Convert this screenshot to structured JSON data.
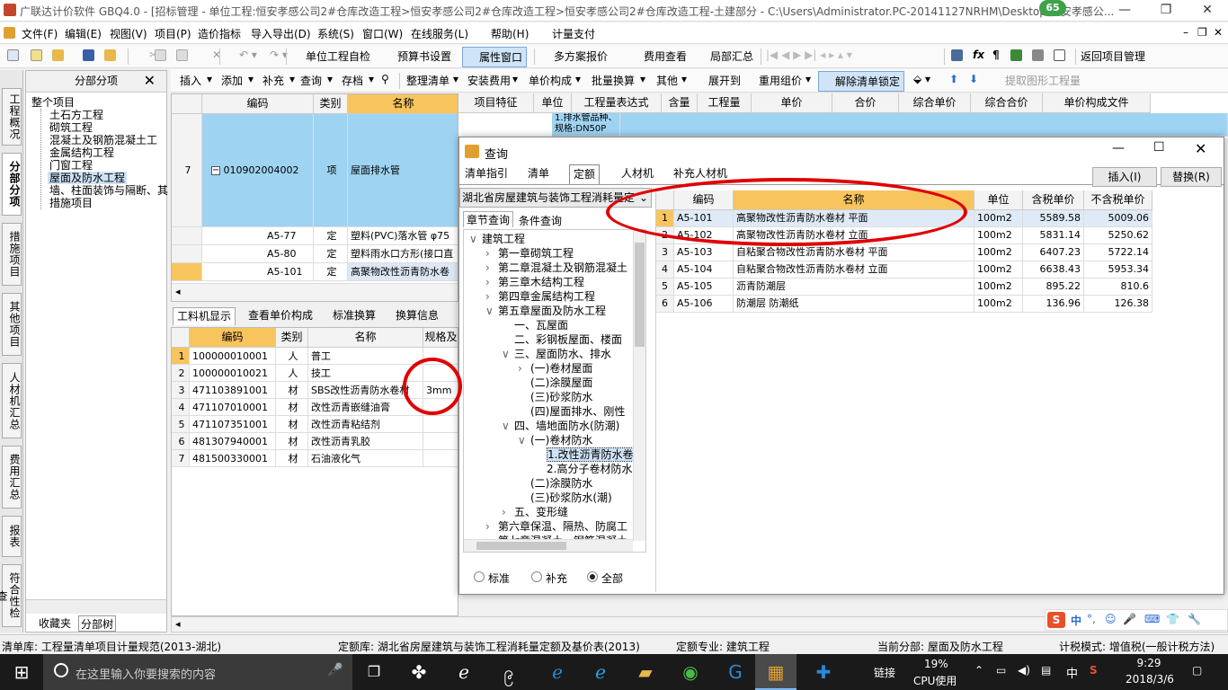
{
  "window": {
    "title": "广联达计价软件 GBQ4.0 - [招标管理 - 单位工程:恒安孝感公司2#仓库改造工程>恒安孝感公司2#仓库改造工程>恒安孝感公司2#仓库改造工程-土建部分 - C:\\Users\\Administrator.PC-20141127NRHM\\Desktop\\恒安孝感公...",
    "badge": "65"
  },
  "menu": [
    "文件(F)",
    "编辑(E)",
    "视图(V)",
    "项目(P)",
    "造价指标",
    "导入导出(D)",
    "系统(S)",
    "窗口(W)",
    "在线服务(L)",
    "帮助(H)",
    "计量支付"
  ],
  "toolbar1": [
    "单位工程自检",
    "预算书设置",
    "属性窗口",
    "多方案报价",
    "费用查看",
    "局部汇总",
    "返回项目管理"
  ],
  "toolbar2": [
    "插入",
    "添加",
    "补充",
    "查询",
    "存档",
    "整理清单",
    "安装费用",
    "单价构成",
    "批量换算",
    "其他",
    "展开到",
    "重用组价",
    "解除清单锁定",
    "提取图形工程量"
  ],
  "vtabs": [
    "工程概况",
    "分部分项",
    "措施项目",
    "其他项目",
    "人材机汇总",
    "费用汇总",
    "报表",
    "符合性检查"
  ],
  "leftpanel": {
    "title": "分部分项",
    "items": [
      "整个项目",
      "土石方工程",
      "砌筑工程",
      "混凝土及钢筋混凝土工",
      "金属结构工程",
      "门窗工程",
      "屋面及防水工程",
      "墙、柱面装饰与隔断、其",
      "措施项目"
    ],
    "bottom_tabs": [
      "收藏夹",
      "分部树"
    ]
  },
  "maingrid": {
    "headers": [
      "编码",
      "类别",
      "名称",
      "项目特征",
      "单位",
      "工程量表达式",
      "含量",
      "工程量",
      "单价",
      "合价",
      "综合单价",
      "综合合价",
      "单价构成文件"
    ],
    "rows": [
      {
        "no": "7",
        "code": "010902004002",
        "type": "项",
        "name": "屋面排水管",
        "feature": "1.排水管品种、规格:DN50P"
      },
      {
        "no": "",
        "code": "A5-77",
        "type": "定",
        "name": "塑料(PVC)落水管 φ75"
      },
      {
        "no": "",
        "code": "A5-80",
        "type": "定",
        "name": "塑料雨水口方形(接口直"
      },
      {
        "no": "",
        "code": "A5-101",
        "type": "定",
        "name": "高聚物改性沥青防水卷"
      }
    ]
  },
  "bottomtabs": [
    "工料机显示",
    "查看单价构成",
    "标准换算",
    "换算信息"
  ],
  "bottomgrid": {
    "headers": [
      "编码",
      "类别",
      "名称",
      "规格及"
    ],
    "rows": [
      {
        "no": "1",
        "code": "100000010001",
        "type": "人",
        "name": "普工",
        "spec": ""
      },
      {
        "no": "2",
        "code": "100000010021",
        "type": "人",
        "name": "技工",
        "spec": ""
      },
      {
        "no": "3",
        "code": "471103891001",
        "type": "材",
        "name": "SBS改性沥青防水卷材",
        "spec": "3mm"
      },
      {
        "no": "4",
        "code": "471107010001",
        "type": "材",
        "name": "改性沥青嵌缝油膏",
        "spec": ""
      },
      {
        "no": "5",
        "code": "471107351001",
        "type": "材",
        "name": "改性沥青粘结剂",
        "spec": ""
      },
      {
        "no": "6",
        "code": "481307940001",
        "type": "材",
        "name": "改性沥青乳胶",
        "spec": ""
      },
      {
        "no": "7",
        "code": "481500330001",
        "type": "材",
        "name": "石油液化气",
        "spec": ""
      }
    ]
  },
  "dialog": {
    "title": "查询",
    "tabs": [
      "清单指引",
      "清单",
      "定额",
      "人材机",
      "补充人材机"
    ],
    "insert": "插入(I)",
    "replace": "替换(R)",
    "library": "湖北省房屋建筑与装饰工程消耗量定",
    "subtabs": [
      "章节查询",
      "条件查询"
    ],
    "tree": [
      {
        "label": "建筑工程",
        "lv": 0,
        "exp": "v"
      },
      {
        "label": "第一章砌筑工程",
        "lv": 1,
        "exp": ">"
      },
      {
        "label": "第二章混凝土及钢筋混凝土",
        "lv": 1,
        "exp": ">"
      },
      {
        "label": "第三章木结构工程",
        "lv": 1,
        "exp": ">"
      },
      {
        "label": "第四章金属结构工程",
        "lv": 1,
        "exp": ">"
      },
      {
        "label": "第五章屋面及防水工程",
        "lv": 1,
        "exp": "v"
      },
      {
        "label": "一、瓦屋面",
        "lv": 2,
        "exp": ""
      },
      {
        "label": "二、彩钢板屋面、楼面",
        "lv": 2,
        "exp": ""
      },
      {
        "label": "三、屋面防水、排水",
        "lv": 2,
        "exp": "v"
      },
      {
        "label": "(一)卷材屋面",
        "lv": 3,
        "exp": ">"
      },
      {
        "label": "(二)涂膜屋面",
        "lv": 3,
        "exp": ""
      },
      {
        "label": "(三)砂浆防水",
        "lv": 3,
        "exp": ""
      },
      {
        "label": "(四)屋面排水、刚性",
        "lv": 3,
        "exp": ""
      },
      {
        "label": "四、墙地面防水(防潮)",
        "lv": 2,
        "exp": "v"
      },
      {
        "label": "(一)卷材防水",
        "lv": 3,
        "exp": "v"
      },
      {
        "label": "1.改性沥青防水卷",
        "lv": 4,
        "exp": ""
      },
      {
        "label": "2.高分子卷材防水",
        "lv": 4,
        "exp": ""
      },
      {
        "label": "(二)涂膜防水",
        "lv": 3,
        "exp": ""
      },
      {
        "label": "(三)砂浆防水(潮)",
        "lv": 3,
        "exp": ""
      },
      {
        "label": "五、变形缝",
        "lv": 2,
        "exp": ">"
      },
      {
        "label": "第六章保温、隔热、防腐工",
        "lv": 1,
        "exp": ">"
      },
      {
        "label": "第七章混凝土、钢筋混凝土",
        "lv": 1,
        "exp": ">"
      }
    ],
    "radios": [
      "标准",
      "补充",
      "全部"
    ],
    "grid_headers": [
      "编码",
      "名称",
      "单位",
      "含税单价",
      "不含税单价"
    ],
    "rows": [
      {
        "no": "1",
        "code": "A5-101",
        "name": "高聚物改性沥青防水卷材 平面",
        "unit": "100m2",
        "tax": "5589.58",
        "notax": "5009.06"
      },
      {
        "no": "2",
        "code": "A5-102",
        "name": "高聚物改性沥青防水卷材 立面",
        "unit": "100m2",
        "tax": "5831.14",
        "notax": "5250.62"
      },
      {
        "no": "3",
        "code": "A5-103",
        "name": "自粘聚合物改性沥青防水卷材 平面",
        "unit": "100m2",
        "tax": "6407.23",
        "notax": "5722.14"
      },
      {
        "no": "4",
        "code": "A5-104",
        "name": "自粘聚合物改性沥青防水卷材 立面",
        "unit": "100m2",
        "tax": "6638.43",
        "notax": "5953.34"
      },
      {
        "no": "5",
        "code": "A5-105",
        "name": "沥青防潮层",
        "unit": "100m2",
        "tax": "895.22",
        "notax": "810.6"
      },
      {
        "no": "6",
        "code": "A5-106",
        "name": "防潮层 防潮纸",
        "unit": "100m2",
        "tax": "136.96",
        "notax": "126.38"
      }
    ]
  },
  "status": {
    "a": "清单库:  工程量清单项目计量规范(2013-湖北)",
    "b": "定额库:  湖北省房屋建筑与装饰工程消耗量定额及基价表(2013)",
    "c": "定额专业:  建筑工程",
    "d": "当前分部:  屋面及防水工程",
    "e": "计税模式: 增值税(一般计税方法)"
  },
  "ime": [
    "中",
    "°,",
    "☺",
    "🎤",
    "⌨",
    "👕",
    "🔧"
  ],
  "taskbar": {
    "search": "在这里输入你要搜索的内容",
    "link": "链接",
    "cpu": "19%",
    "cpu_label": "CPU使用",
    "ime": "中",
    "time": "9:29",
    "date": "2018/3/6"
  }
}
